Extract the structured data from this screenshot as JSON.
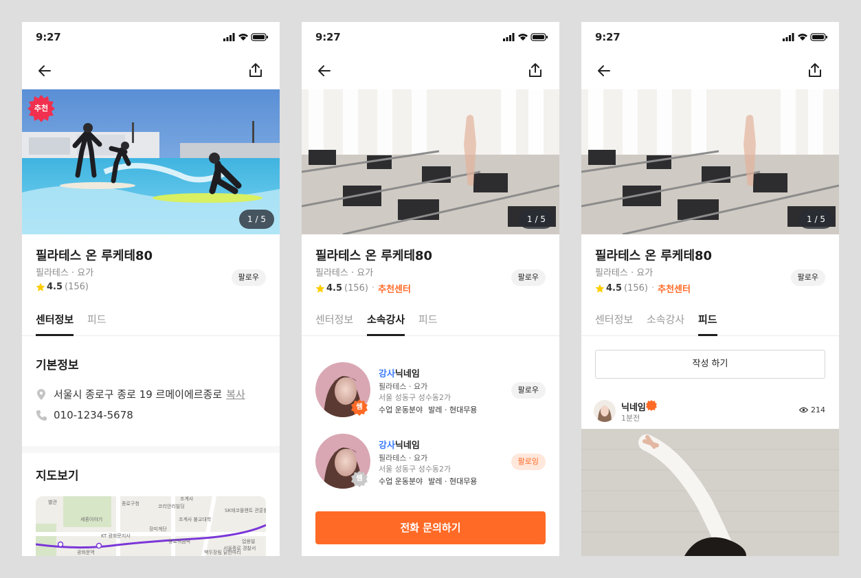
{
  "status": {
    "time": "9:27"
  },
  "center": {
    "name": "필라테스 온 루케테80",
    "category": "필라테스 · 요가",
    "rating": "4.5",
    "review_count": "(156)",
    "recommended": "추천센터",
    "follow_label": "팔로우",
    "photo_counter": "1 / 5",
    "recommend_badge": "추천"
  },
  "screen1": {
    "tabs": [
      "센터정보",
      "피드"
    ],
    "basic_info_title": "기본정보",
    "address": "서울시 종로구 종로 19 르메이에르종로",
    "copy_label": "복사",
    "phone": "010-1234-5678",
    "map_title": "지도보기",
    "map_labels": [
      "종로구청",
      "조계사",
      "SK에코플랜트 관훈빌딩",
      "조계사 불교대학",
      "KT 광화문지사",
      "종로귀금속",
      "서울종로 경찰서",
      "광화문역",
      "코리안리빌딩",
      "세종이야기",
      "별관",
      "장미계단",
      "백두장림 닭한마리",
      "업용빌"
    ]
  },
  "screen2": {
    "tabs": [
      "센터정보",
      "소속강사",
      "피드"
    ],
    "instructors": [
      {
        "name_prefix": "강사",
        "name": "닉네임",
        "category": "필라테스 · 요가",
        "location": "서울 성동구 성수동2가",
        "field_label": "수업 운동분야",
        "fields": "발레 · 현대무용",
        "badge": "쌤",
        "button": "팔로우"
      },
      {
        "name_prefix": "강사",
        "name": "닉네임",
        "category": "필라테스 · 요가",
        "location": "서울 성동구 성수동2가",
        "field_label": "수업 운동분야",
        "fields": "발레 · 현대무용",
        "badge": "쌤",
        "button": "팔로잉"
      }
    ],
    "cta": "전화 문의하기"
  },
  "screen3": {
    "tabs": [
      "센터정보",
      "소속강사",
      "피드"
    ],
    "write_button": "작성 하기",
    "post": {
      "author": "닉네임",
      "time": "1분전",
      "views": "214"
    }
  },
  "colors": {
    "accent": "#ff6a26",
    "link_blue": "#3a7bff",
    "recommend_red": "#f0304e"
  }
}
